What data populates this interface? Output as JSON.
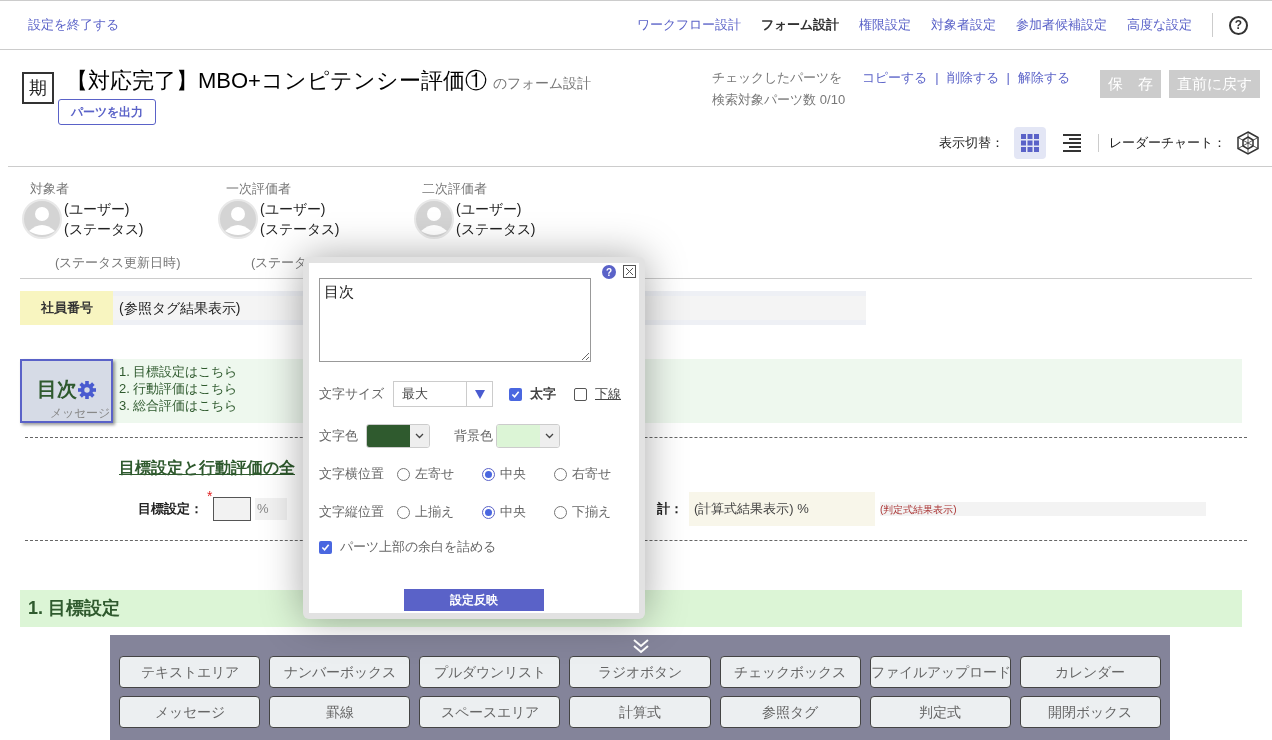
{
  "nav": {
    "exit_link": "設定を終了する",
    "items": [
      {
        "label": "ワークフロー設計",
        "selected": false
      },
      {
        "label": "フォーム設計",
        "selected": true
      },
      {
        "label": "権限設定",
        "selected": false
      },
      {
        "label": "対象者設定",
        "selected": false
      },
      {
        "label": "参加者候補設定",
        "selected": false
      },
      {
        "label": "高度な設定",
        "selected": false
      }
    ],
    "help": "?"
  },
  "header": {
    "period_badge": "期",
    "title": "【対応完了】MBO+コンピテンシー評価①",
    "title_suffix": "のフォーム設計",
    "export_button": "パーツを出力",
    "checked_parts_label": "チェックしたパーツを",
    "actions": [
      "コピーする",
      "削除する",
      "解除する"
    ],
    "separator": "|",
    "search_count": "検索対象パーツ数 0/10",
    "buttons": [
      {
        "label": "保　存",
        "disabled": true
      },
      {
        "label": "直前に戻す",
        "disabled": true
      }
    ],
    "view_label": "表示切替：",
    "views": [
      {
        "kind": "grid",
        "selected": true
      },
      {
        "kind": "list",
        "selected": false
      }
    ],
    "radar_label": "レーダーチャート："
  },
  "evaluators": [
    {
      "role": "対象者",
      "user": "(ユーザー)",
      "status": "(ステータス)"
    },
    {
      "role": "一次評価者",
      "user": "(ユーザー)",
      "status": "(ステータス)"
    },
    {
      "role": "二次評価者",
      "user": "(ユーザー)",
      "status": "(ステータス)"
    }
  ],
  "status_dates": [
    "(ステータス更新日時)",
    "(ステータ"
  ],
  "employee_row": {
    "label": "社員番号",
    "value": "(参照タグ結果表示)"
  },
  "message_part": {
    "title": "目次",
    "caption": "メッセージ",
    "lines": [
      "1. 目標設定はこちら",
      "2. 行動評価はこちら",
      "3. 総合評価はこちら"
    ]
  },
  "summary": {
    "heading": "目標設定と行動評価の全",
    "goal_label": "目標設定：",
    "required": "*",
    "unit": "%",
    "total_label": "計：",
    "total_value": "(計算式結果表示) %",
    "judge_value": "(判定式結果表示)"
  },
  "section_heading": "1. 目標設定",
  "dialog": {
    "help": "?",
    "text": "目次",
    "font_size_label": "文字サイズ",
    "font_size": "最大",
    "bold": {
      "label": "太字",
      "checked": true
    },
    "underline": {
      "label": "下線",
      "checked": false
    },
    "text_color": {
      "label": "文字色",
      "color": "#2f5a2e"
    },
    "bg_color": {
      "label": "背景色",
      "color": "#dcf5d6"
    },
    "h_align": {
      "label": "文字横位置",
      "options": [
        {
          "label": "左寄せ",
          "selected": false
        },
        {
          "label": "中央",
          "selected": true
        },
        {
          "label": "右寄せ",
          "selected": false
        }
      ]
    },
    "v_align": {
      "label": "文字縦位置",
      "options": [
        {
          "label": "上揃え",
          "selected": false
        },
        {
          "label": "中央",
          "selected": true
        },
        {
          "label": "下揃え",
          "selected": false
        }
      ]
    },
    "compact": {
      "label": "パーツ上部の余白を詰める",
      "checked": true
    },
    "apply_button": "設定反映"
  },
  "palette": {
    "items": [
      "テキストエリア",
      "ナンバーボックス",
      "プルダウンリスト",
      "ラジオボタン",
      "チェックボックス",
      "ファイルアップロード",
      "カレンダー",
      "メッセージ",
      "罫線",
      "スペースエリア",
      "計算式",
      "参照タグ",
      "判定式",
      "開閉ボックス"
    ]
  }
}
